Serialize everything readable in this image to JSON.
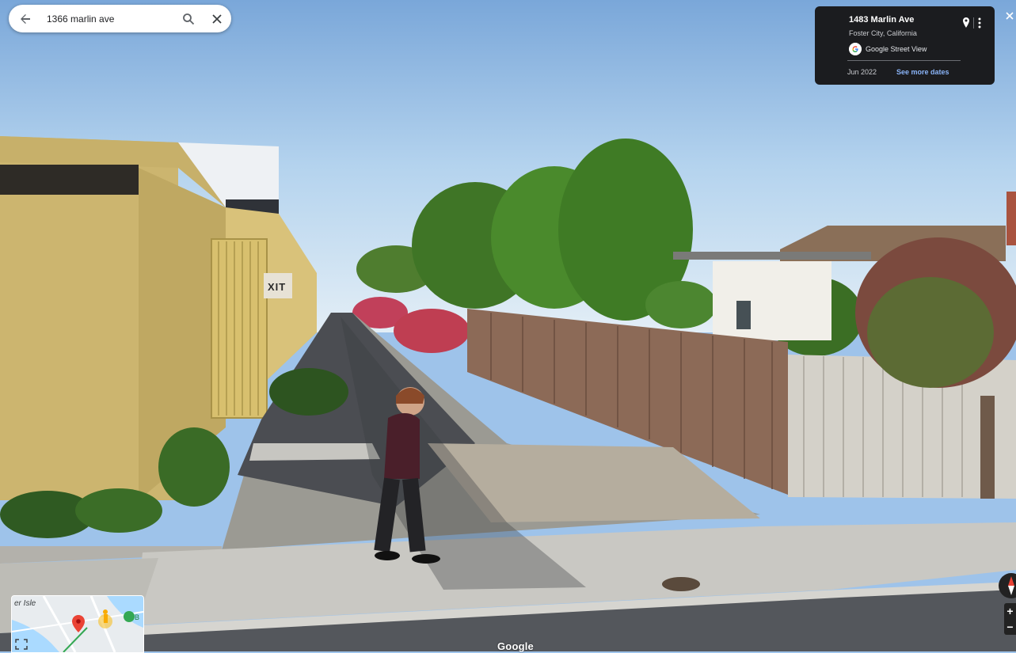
{
  "search": {
    "query": "1366 marlin ave"
  },
  "info_card": {
    "title": "1483 Marlin Ave",
    "subtitle": "Foster City, California",
    "source": "Google Street View",
    "date": "Jun 2022",
    "more_dates": "See more dates"
  },
  "scene": {
    "sign_text": "XIT",
    "watermark": "Google"
  },
  "minimap": {
    "place_label": "er Isle"
  },
  "zoom": {
    "in": "+",
    "out": "−"
  },
  "icons": {
    "back": "back-arrow-icon",
    "search": "search-icon",
    "clear": "close-icon",
    "pin": "location-pin-icon",
    "more": "more-vert-icon",
    "close": "close-icon",
    "expand": "fullscreen-icon",
    "compass": "compass-icon"
  },
  "colors": {
    "card_bg": "#1b1c1f",
    "link": "#8ab4f8",
    "pin": "#ea4335"
  }
}
